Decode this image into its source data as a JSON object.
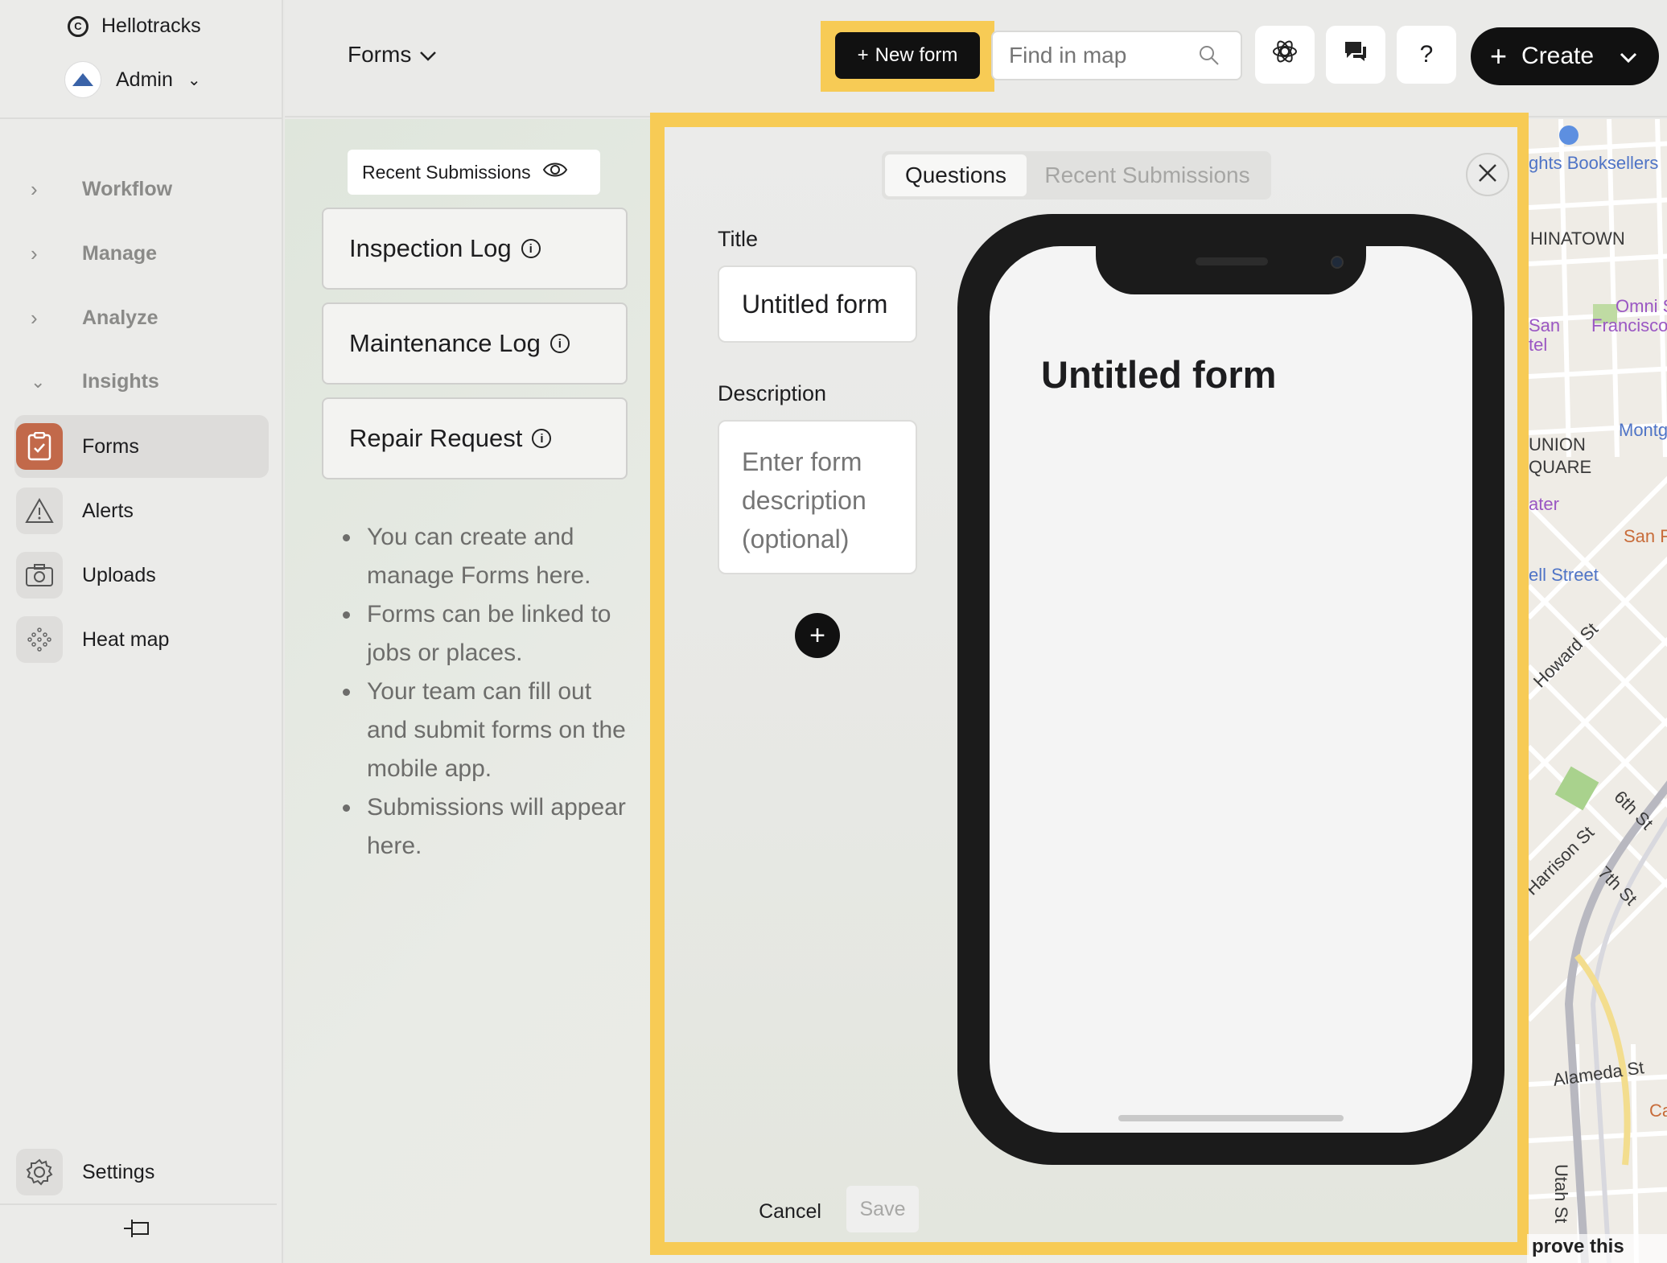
{
  "sidebar": {
    "brand": "Hellotracks",
    "org_name": "Admin",
    "groups": [
      {
        "label": "Workflow",
        "expanded": false
      },
      {
        "label": "Manage",
        "expanded": false
      },
      {
        "label": "Analyze",
        "expanded": false
      },
      {
        "label": "Insights",
        "expanded": true
      }
    ],
    "items": [
      {
        "label": "Forms",
        "icon": "clipboard-check-icon",
        "active": true
      },
      {
        "label": "Alerts",
        "icon": "warning-triangle-icon",
        "active": false
      },
      {
        "label": "Uploads",
        "icon": "camera-icon",
        "active": false
      },
      {
        "label": "Heat map",
        "icon": "dots-grid-icon",
        "active": false
      }
    ],
    "settings_label": "Settings"
  },
  "topbar": {
    "section_title": "Forms",
    "new_form_label": "New form",
    "search_placeholder": "Find in map",
    "help_label": "?",
    "create_label": "Create"
  },
  "forms_panel": {
    "recent_submissions_label": "Recent Submissions",
    "forms": [
      {
        "name": "Inspection Log"
      },
      {
        "name": "Maintenance Log"
      },
      {
        "name": "Repair Request"
      }
    ],
    "tips": [
      "You can create and manage Forms here.",
      "Forms can be linked to jobs or places.",
      "Your team can fill out and submit forms on the mobile app.",
      "Submissions will appear here."
    ]
  },
  "modal": {
    "tabs": [
      {
        "label": "Questions",
        "active": true
      },
      {
        "label": "Recent Submissions",
        "active": false
      }
    ],
    "title_label": "Title",
    "title_value": "Untitled form",
    "description_label": "Description",
    "description_placeholder": "Enter form description (optional)",
    "preview_title": "Untitled form",
    "cancel_label": "Cancel",
    "save_label": "Save"
  },
  "map": {
    "labels": [
      {
        "text": "ghts Booksellers",
        "color": "blue"
      },
      {
        "text": "HINATOWN",
        "color": "dark"
      },
      {
        "text": "Omni S",
        "color": "purple"
      },
      {
        "text": "Francisco",
        "color": "purple"
      },
      {
        "text": "San",
        "color": "purple"
      },
      {
        "text": "tel",
        "color": "purple"
      },
      {
        "text": "UNION",
        "color": "dark"
      },
      {
        "text": "QUARE",
        "color": "dark"
      },
      {
        "text": "Montg",
        "color": "blue"
      },
      {
        "text": "ater",
        "color": "purple"
      },
      {
        "text": "San F",
        "color": "orange"
      },
      {
        "text": "ell Street",
        "color": "blue"
      },
      {
        "text": "Howard St",
        "color": "dark"
      },
      {
        "text": "6th St",
        "color": "dark"
      },
      {
        "text": "Harrison St",
        "color": "dark"
      },
      {
        "text": "7th St",
        "color": "dark"
      },
      {
        "text": "Alameda St",
        "color": "dark"
      },
      {
        "text": "Ca",
        "color": "orange"
      },
      {
        "text": "Utah St",
        "color": "dark"
      }
    ],
    "improve_label": "prove this map"
  },
  "colors": {
    "highlight": "#f7cb55",
    "active_icon_bg": "#c2694a",
    "primary_button": "#111111"
  }
}
